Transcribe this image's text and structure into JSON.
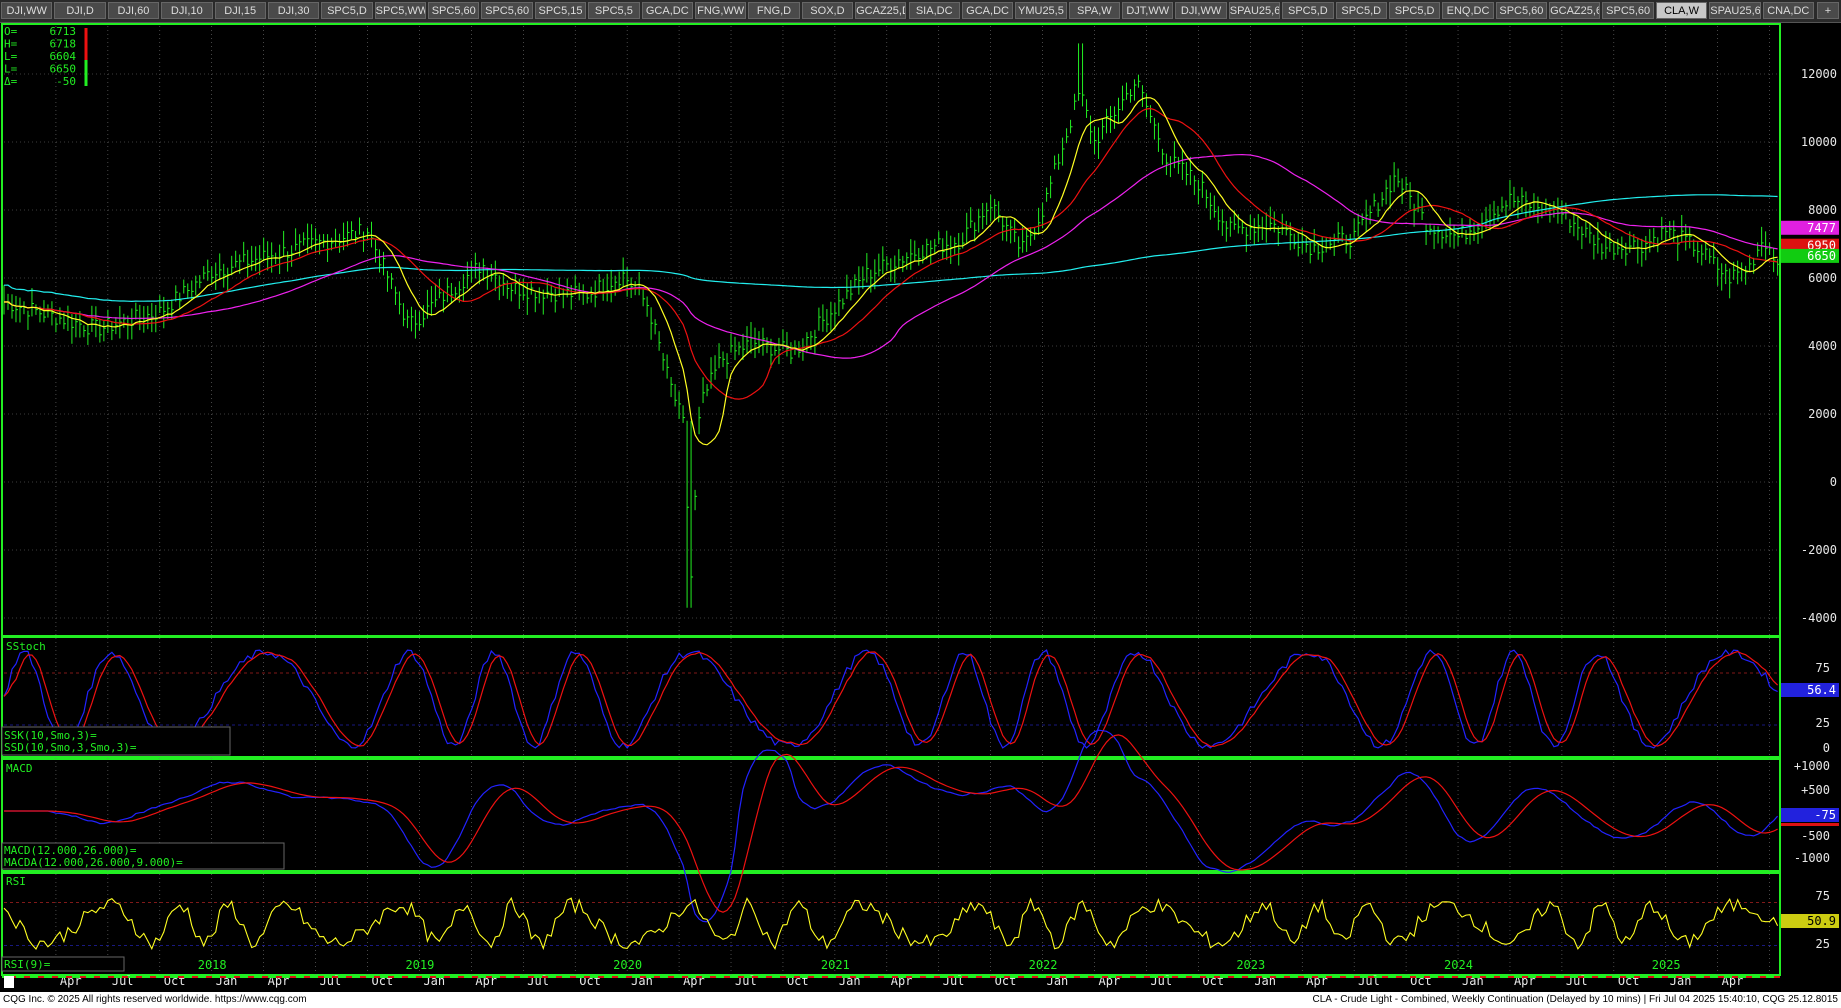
{
  "tabs": [
    "DJI,WW",
    "DJI,D",
    "DJI,60",
    "DJI,10",
    "DJI,15",
    "DJI,30",
    "SPC5,D",
    "SPC5,WW",
    "SPC5,60",
    "SPC5,60",
    "SPC5,15",
    "SPC5,5",
    "GCA,DC",
    "FNG,WW",
    "FNG,D",
    "SOX,D",
    "GCAZ25,D",
    "SIA,DC",
    "GCA,DC",
    "YMU25,5",
    "SPA,W",
    "DJT,WW",
    "DJI,WW",
    "SPAU25,60",
    "SPC5,D",
    "SPC5,D",
    "SPC5,D",
    "ENQ,DC",
    "SPC5,60",
    "GCAZ25,60",
    "SPC5,60",
    "CLA,W",
    "SPAU25,60",
    "CNA,DC",
    "+"
  ],
  "active_tab": "CLA,W",
  "ohlc": {
    "o_label": "O=",
    "o_value": "6713",
    "h_label": "H=",
    "h_value": "6718",
    "l_label": "L=",
    "l_value": "6604",
    "c_label": "L=",
    "c_value": "6650",
    "d_label": "Δ=",
    "d_value": "-50"
  },
  "price_axis": [
    "12000",
    "10000",
    "8000",
    "6000",
    "4000",
    "2000",
    "0",
    "-2000",
    "-4000"
  ],
  "price_badges": [
    {
      "text": "7477",
      "color": "#e020e0"
    },
    {
      "text": "6950",
      "color": "#dd1111"
    },
    {
      "text": "6650",
      "color": "#11cc11"
    }
  ],
  "sstoch": {
    "title": "SStoch",
    "label1": "SSK(10,Smo,3)=",
    "label2": "SSD(10,Smo,3,Smo,3)=",
    "axis": [
      "75",
      "25",
      "0"
    ],
    "badge": "56.4"
  },
  "macd": {
    "title": "MACD",
    "label1": "MACD(12.000,26.000)=",
    "label2": "MACDA(12.000,26.000,9.000)=",
    "axis": [
      "+1000",
      "+500",
      "-500",
      "-1000"
    ],
    "badge": "-75"
  },
  "rsi": {
    "title": "RSI",
    "label1": "RSI(9)=",
    "axis": [
      "75",
      "50",
      "25"
    ],
    "badge": "50.9"
  },
  "time_axis": {
    "years": [
      "2018",
      "2019",
      "2020",
      "2021",
      "2022",
      "2023",
      "2024",
      "2025"
    ],
    "months": [
      "Apr",
      "Jul",
      "Oct",
      "Jan",
      "Apr",
      "Jul",
      "Oct",
      "Jan",
      "Apr",
      "Jul",
      "Oct",
      "Jan",
      "Apr",
      "Jul",
      "Oct",
      "Jan",
      "Apr",
      "Jul",
      "Oct",
      "Jan",
      "Apr",
      "Jul",
      "Oct",
      "Jan",
      "Apr",
      "Jul",
      "Oct",
      "Jan",
      "Apr",
      "Jul",
      "Oct",
      "Jan",
      "Apr"
    ]
  },
  "colors": {
    "bars": "#22ee22",
    "ma_fast": "#ffff22",
    "ma_mid": "#ee1111",
    "ma_slow": "#ee22ee",
    "ma_long": "#22eeee",
    "stoch_k": "#2222ff",
    "stoch_d": "#ee1111",
    "rsi": "#ffff22",
    "panel_border": "#22ee22",
    "axis_text": "#e8e8e8",
    "label_text": "#22ee22"
  },
  "footer": {
    "left": "CQG Inc. © 2025 All rights reserved worldwide. https://www.cqg.com",
    "right": "CLA - Crude Light - Combined, Weekly Continuation (Delayed by 10 mins) | Fri Jul 04 2025 15:40:10, CQG 25.12.8015"
  }
}
